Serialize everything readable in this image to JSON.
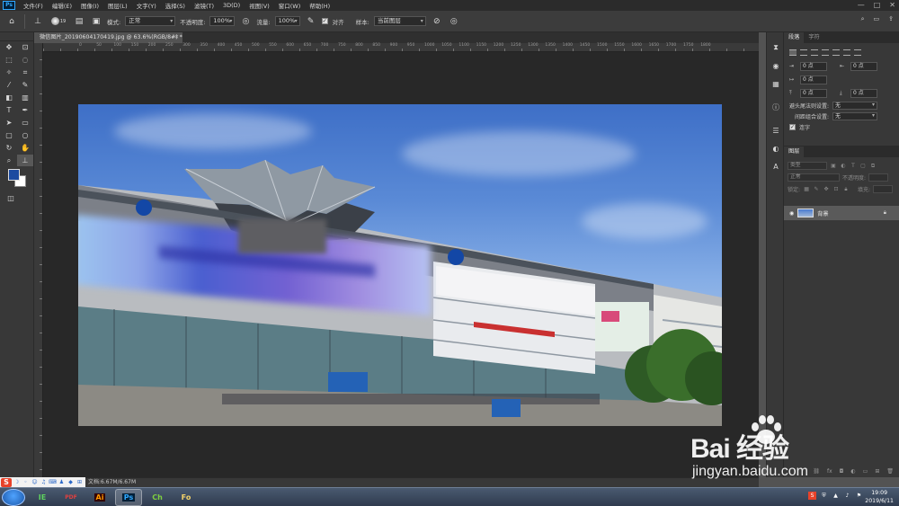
{
  "app": {
    "logo": "Ps",
    "menu": [
      "文件(F)",
      "编辑(E)",
      "图像(I)",
      "图层(L)",
      "文字(Y)",
      "选择(S)",
      "滤镜(T)",
      "3D(D)",
      "视图(V)",
      "窗口(W)",
      "帮助(H)"
    ],
    "window_controls": [
      "—",
      "□",
      "✕"
    ]
  },
  "options_bar": {
    "brush_size": "19",
    "mode_label": "模式:",
    "mode_value": "正常",
    "opacity_label": "不透明度:",
    "opacity_value": "100%",
    "flow_label": "流量:",
    "flow_value": "100%",
    "align_label": "对齐",
    "sample_label": "样本:",
    "sample_value": "当前图层"
  },
  "document": {
    "tab_title": "微信图片_20190604170419.jpg @ 63.6%(RGB/8#) *",
    "ruler_ticks": [
      "0",
      "50",
      "100",
      "150",
      "200",
      "250",
      "300",
      "350",
      "400",
      "450",
      "500",
      "550",
      "600",
      "650",
      "700",
      "750",
      "800",
      "850",
      "900",
      "950",
      "1000",
      "1050",
      "1100",
      "1150",
      "1200",
      "1250",
      "1300",
      "1350",
      "1400",
      "1450",
      "1500",
      "1550",
      "1600",
      "1650",
      "1700",
      "1750",
      "1800"
    ]
  },
  "paragraph_panel": {
    "tabs": [
      "段落",
      "字符"
    ],
    "indent_values": [
      "0 点",
      "0 点",
      "0 点",
      "0 点",
      "0 点"
    ],
    "kinsoku_label": "避头尾法则设置:",
    "kinsoku_value": "无",
    "mojikumi_label": "间距组合设置:",
    "mojikumi_value": "无",
    "hyphenate_label": "连字"
  },
  "layers_panel": {
    "tab": "图层",
    "filter_kind": "类型",
    "blend_mode": "正常",
    "opacity_label": "不透明度:",
    "lock_label": "锁定:",
    "fill_label": "填充:",
    "layer_name": "背景"
  },
  "status": {
    "zoom_text": "63.6",
    "doc_info": "文档:6.67M/6.67M"
  },
  "taskbar": {
    "time": "19:09",
    "date": "2019/6/11",
    "apps": [
      "IE",
      "PDF",
      "Ai",
      "Ps",
      "Ch",
      "Fo"
    ]
  },
  "watermark": {
    "main": "Bai  经验",
    "url": "jingyan.baidu.com"
  },
  "colors": {
    "foreground": "#1c4ba0",
    "background": "#ffffff",
    "ps_blue": "#31a8ff"
  }
}
